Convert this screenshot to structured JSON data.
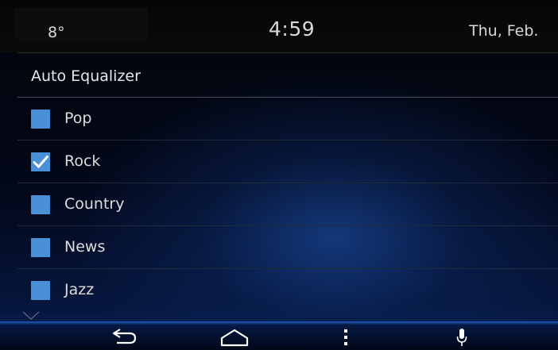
{
  "status": {
    "temperature": "8°",
    "time": "4:59",
    "date": "Thu, Feb."
  },
  "header": {
    "title": "Auto Equalizer"
  },
  "options": [
    {
      "label": "Pop",
      "checked": false
    },
    {
      "label": "Rock",
      "checked": true
    },
    {
      "label": "Country",
      "checked": false
    },
    {
      "label": "News",
      "checked": false
    },
    {
      "label": "Jazz",
      "checked": false
    }
  ],
  "navbar": {
    "icons": [
      "back-icon",
      "home-icon",
      "menu-dots-icon",
      "microphone-icon"
    ]
  },
  "colors": {
    "checkbox": "#4a90d6",
    "accent_blue": "#1e5fc0"
  }
}
